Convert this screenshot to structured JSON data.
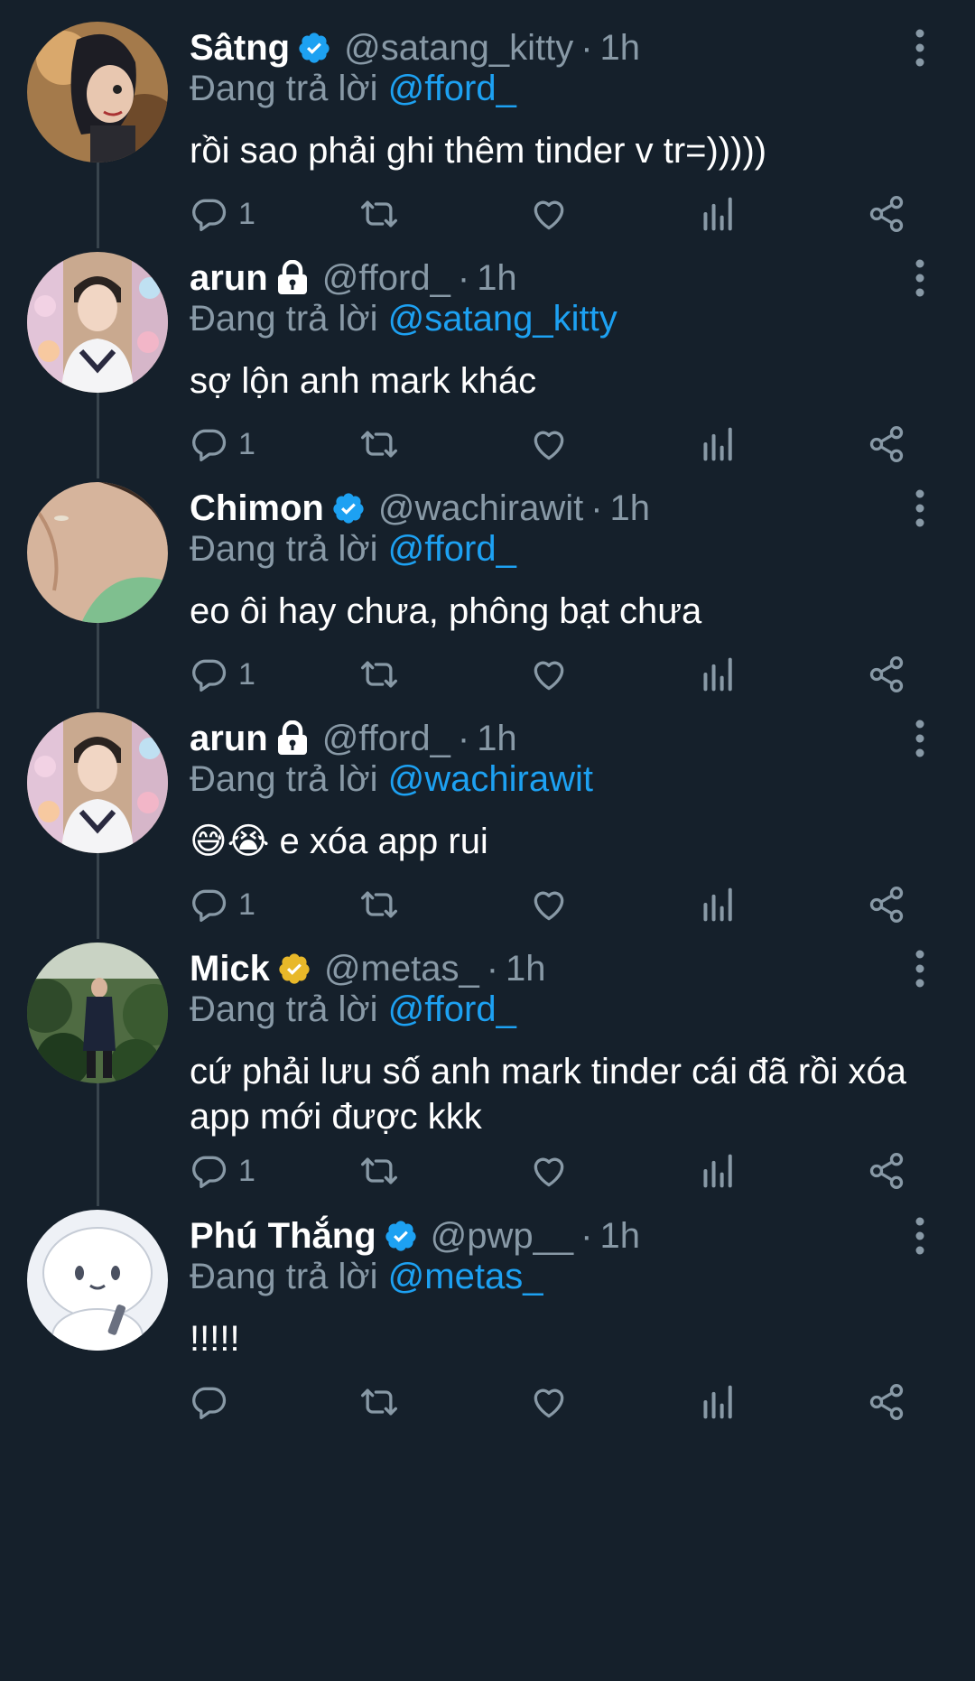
{
  "colors": {
    "background": "#15202b",
    "muted": "#8899a6",
    "accent": "#1da1f2",
    "gold": "#e8b829"
  },
  "reply_prefix": "Đang trả lời",
  "tweets": [
    {
      "name": "Sâtng",
      "badge": "verified-blue",
      "handle": "@satang_kitty",
      "time": "1h",
      "reply_to": "@fford_",
      "text": "rồi sao phải ghi thêm tinder v tr=)))))",
      "reply_count": "1"
    },
    {
      "name": "arun",
      "badge": "lock",
      "handle": "@fford_",
      "time": "1h",
      "reply_to": "@satang_kitty",
      "text": "sợ lộn anh mark khác",
      "reply_count": "1"
    },
    {
      "name": "Chimon",
      "badge": "verified-blue",
      "handle": "@wachirawit",
      "time": "1h",
      "reply_to": "@fford_",
      "text": "eo ôi hay chưa, phông bạt chưa",
      "reply_count": "1"
    },
    {
      "name": "arun",
      "badge": "lock",
      "handle": "@fford_",
      "time": "1h",
      "reply_to": "@wachirawit",
      "text": "😅😭 e xóa app rui",
      "reply_count": "1"
    },
    {
      "name": "Mick",
      "badge": "verified-gold",
      "handle": "@metas_",
      "time": "1h",
      "reply_to": "@fford_",
      "text": "cứ phải lưu số anh mark tinder cái đã rồi xóa app mới được kkk",
      "reply_count": "1"
    },
    {
      "name": "Phú Thắng",
      "badge": "verified-blue",
      "handle": "@pwp__",
      "time": "1h",
      "reply_to": "@metas_",
      "text": "!!!!!",
      "reply_count": ""
    }
  ],
  "icons": [
    "verified-icon",
    "lock-icon",
    "more-icon",
    "reply-icon",
    "retweet-icon",
    "like-icon",
    "analytics-icon",
    "share-icon"
  ]
}
